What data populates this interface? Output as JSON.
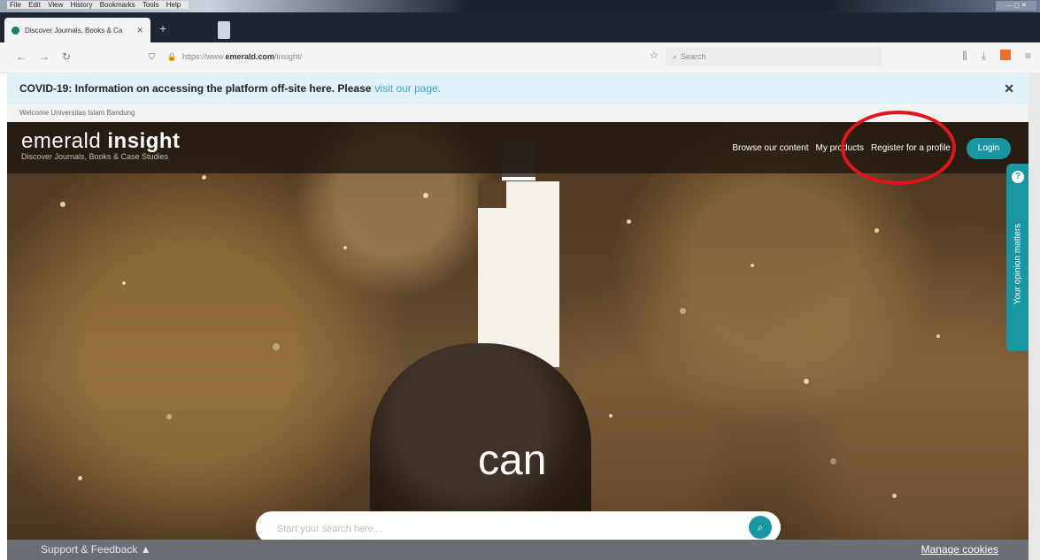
{
  "browser": {
    "menu_items": [
      "File",
      "Edit",
      "View",
      "History",
      "Bookmarks",
      "Tools",
      "Help"
    ],
    "tab_title": "Discover Journals, Books & Ca",
    "url_prefix": "https://www.",
    "url_domain": "emerald.com",
    "url_path": "/insight/",
    "search_placeholder": "Search"
  },
  "banner": {
    "message": "COVID-19: Information on accessing the platform off-site here. Please",
    "link": "visit our page."
  },
  "welcome": "Welcome Universitas Islam Bandung",
  "site": {
    "logo_a": "emerald",
    "logo_b": "insight",
    "tagline": "Discover Journals, Books & Case Studies",
    "nav": [
      "Browse our content",
      "My products",
      "Register for a profile"
    ],
    "login": "Login"
  },
  "hero": {
    "word": "can",
    "search_placeholder": "Start your search here..."
  },
  "feedback_tab": "Your opinion matters",
  "footer": {
    "support": "Support & Feedback ▲",
    "cookies": "Manage cookies"
  },
  "colors": {
    "accent": "#1a96a3",
    "banner_bg": "#dff1f8",
    "annotation_red": "#e1141b"
  }
}
